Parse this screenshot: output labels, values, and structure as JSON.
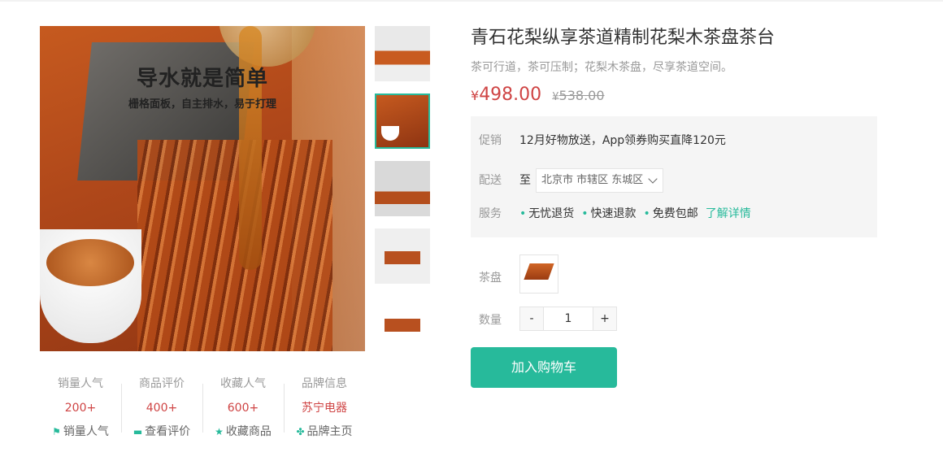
{
  "gallery": {
    "main_image": {
      "headline": "导水就是简单",
      "subline": "栅格面板，自主排水，易于打理"
    },
    "active_thumbnail": 1
  },
  "stats": [
    {
      "label": "销量人气",
      "value": "200+",
      "link": "销量人气",
      "icon": "flag-icon"
    },
    {
      "label": "商品评价",
      "value": "400+",
      "link": "查看评价",
      "icon": "comment-icon"
    },
    {
      "label": "收藏人气",
      "value": "600+",
      "link": "收藏商品",
      "icon": "star-icon"
    },
    {
      "label": "品牌信息",
      "value": "苏宁电器",
      "link": "品牌主页",
      "icon": "pinwheel-icon"
    }
  ],
  "product": {
    "title": "青石花梨纵享茶道精制花梨木茶盘茶台",
    "desc": "茶可行道，茶可压制；花梨木茶盘，尽享茶道空间。",
    "currency": "¥",
    "price": "498.00",
    "old_price": "538.00"
  },
  "promo": {
    "promo_label": "促销",
    "promo_text": "12月好物放送，App领券购买直降120元",
    "delivery_label": "配送",
    "delivery_prefix": "至",
    "address": "北京市 市辖区 东城区",
    "service_label": "服务",
    "services": [
      "无忧退货",
      "快速退款",
      "免费包邮"
    ],
    "more_link": "了解详情"
  },
  "spec": {
    "label": "茶盘"
  },
  "quantity": {
    "label": "数量",
    "minus": "-",
    "value": "1",
    "plus": "+"
  },
  "cart_button": "加入购物车",
  "colors": {
    "accent": "#27ba9b",
    "price": "#cf4444"
  }
}
